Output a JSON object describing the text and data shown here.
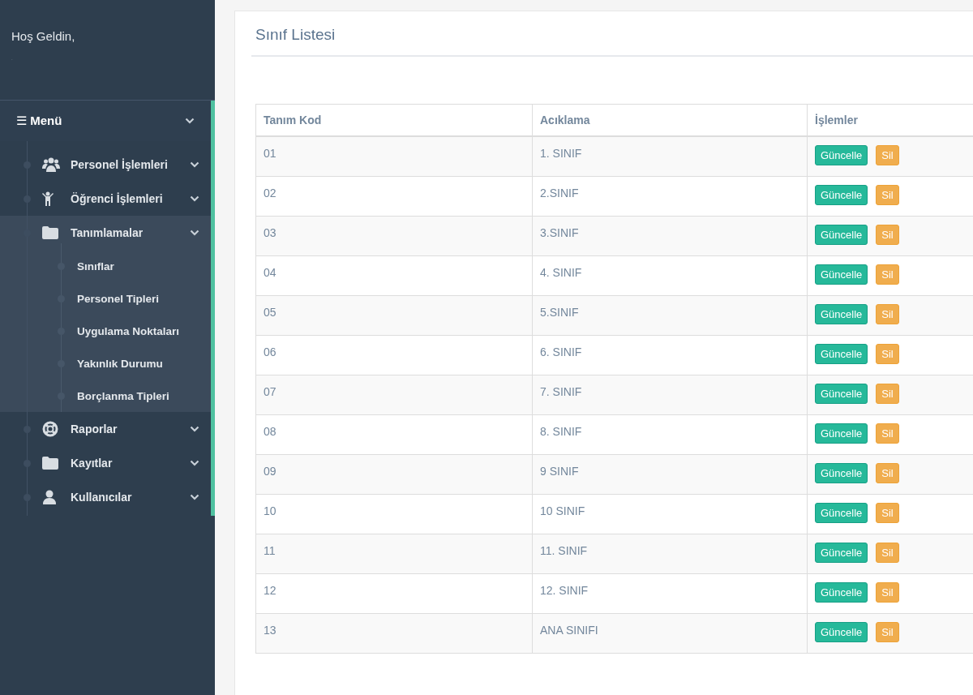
{
  "sidebar": {
    "greeting": "Hoş Geldin,",
    "user_name": ".",
    "menu": {
      "icon": "☰",
      "label": "Menü",
      "expanded": true
    },
    "items": [
      {
        "label": "Personel İşlemleri",
        "expanded": false
      },
      {
        "label": "Öğrenci İşlemleri",
        "expanded": false
      },
      {
        "label": "Tanımlamalar",
        "expanded": true,
        "children": [
          {
            "label": "Sınıflar"
          },
          {
            "label": "Personel Tipleri"
          },
          {
            "label": "Uygulama Noktaları"
          },
          {
            "label": "Yakınlık Durumu"
          },
          {
            "label": "Borçlanma Tipleri"
          }
        ]
      },
      {
        "label": "Raporlar",
        "expanded": false
      },
      {
        "label": "Kayıtlar",
        "expanded": false
      },
      {
        "label": "Kullanıcılar",
        "expanded": false
      }
    ]
  },
  "page": {
    "title": "Sınıf Listesi"
  },
  "table": {
    "columns": [
      "Tanım Kod",
      "Acıklama",
      "İşlemler"
    ],
    "rows": [
      {
        "code": "01",
        "description": "1. SINIF",
        "actions": [
          "Güncelle",
          "Sil"
        ]
      },
      {
        "code": "02",
        "description": "2.SINIF",
        "actions": [
          "Güncelle",
          "Sil"
        ]
      },
      {
        "code": "03",
        "description": "3.SINIF",
        "actions": [
          "Güncelle",
          "Sil"
        ]
      },
      {
        "code": "04",
        "description": "4. SINIF",
        "actions": [
          "Güncelle",
          "Sil"
        ]
      },
      {
        "code": "05",
        "description": "5.SINIF",
        "actions": [
          "Güncelle",
          "Sil"
        ]
      },
      {
        "code": "06",
        "description": "6. SINIF",
        "actions": [
          "Güncelle",
          "Sil"
        ]
      },
      {
        "code": "07",
        "description": "7. SINIF",
        "actions": [
          "Güncelle",
          "Sil"
        ]
      },
      {
        "code": "08",
        "description": "8. SINIF",
        "actions": [
          "Güncelle",
          "Sil"
        ]
      },
      {
        "code": "09",
        "description": "9 SINIF",
        "actions": [
          "Güncelle",
          "Sil"
        ]
      },
      {
        "code": "10",
        "description": "10 SINIF",
        "actions": [
          "Güncelle",
          "Sil"
        ]
      },
      {
        "code": "11",
        "description": "11. SINIF",
        "actions": [
          "Güncelle",
          "Sil"
        ]
      },
      {
        "code": "12",
        "description": "12. SINIF",
        "actions": [
          "Güncelle",
          "Sil"
        ]
      },
      {
        "code": "13",
        "description": "ANA SINIFI",
        "actions": [
          "Güncelle",
          "Sil"
        ]
      }
    ]
  }
}
